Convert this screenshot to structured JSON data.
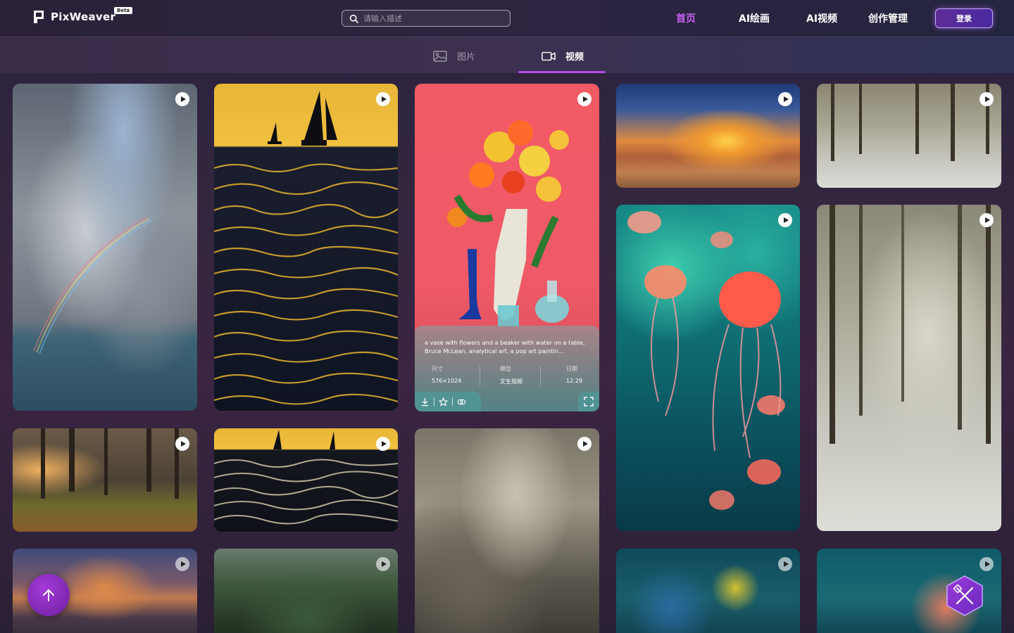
{
  "brand": {
    "name": "PixWeaver",
    "badge": "Beta"
  },
  "search": {
    "placeholder": "请输入描述"
  },
  "nav": {
    "items": [
      {
        "label": "首页",
        "active": true
      },
      {
        "label": "AI绘画",
        "active": false
      },
      {
        "label": "AI视频",
        "active": false
      },
      {
        "label": "创作管理",
        "active": false
      }
    ],
    "login_label": "登录"
  },
  "tabs": [
    {
      "label": "图片",
      "icon": "image-icon",
      "active": false
    },
    {
      "label": "视频",
      "icon": "video-icon",
      "active": true
    }
  ],
  "featured": {
    "description": "a vase with flowers and a beaker with water on a table, Bruce McLean, analytical art, a pop art paintin...",
    "meta": [
      {
        "key": "尺寸",
        "value": "576×1024"
      },
      {
        "key": "模型",
        "value": "文生视频"
      },
      {
        "key": "日期",
        "value": "12.29"
      }
    ]
  },
  "cards": [
    {
      "subject": "rainbow-clouds-sea"
    },
    {
      "subject": "yellow-sea-sailboats"
    },
    {
      "subject": "vase-flowers-pop-art"
    },
    {
      "subject": "sunset-beach"
    },
    {
      "subject": "snowy-forest"
    },
    {
      "subject": "jellyfish"
    },
    {
      "subject": "snowy-forest-tall"
    },
    {
      "subject": "misty-forest-path"
    },
    {
      "subject": "waves-sailboats"
    },
    {
      "subject": "dramatic-clouds"
    },
    {
      "subject": "sunset-sky"
    },
    {
      "subject": "green-valley"
    },
    {
      "subject": "tropical-fish"
    },
    {
      "subject": "coral-reef"
    }
  ],
  "colors": {
    "accent": "#c660f0",
    "underline": "#b44ce6",
    "login_border": "#c8a7ff"
  }
}
